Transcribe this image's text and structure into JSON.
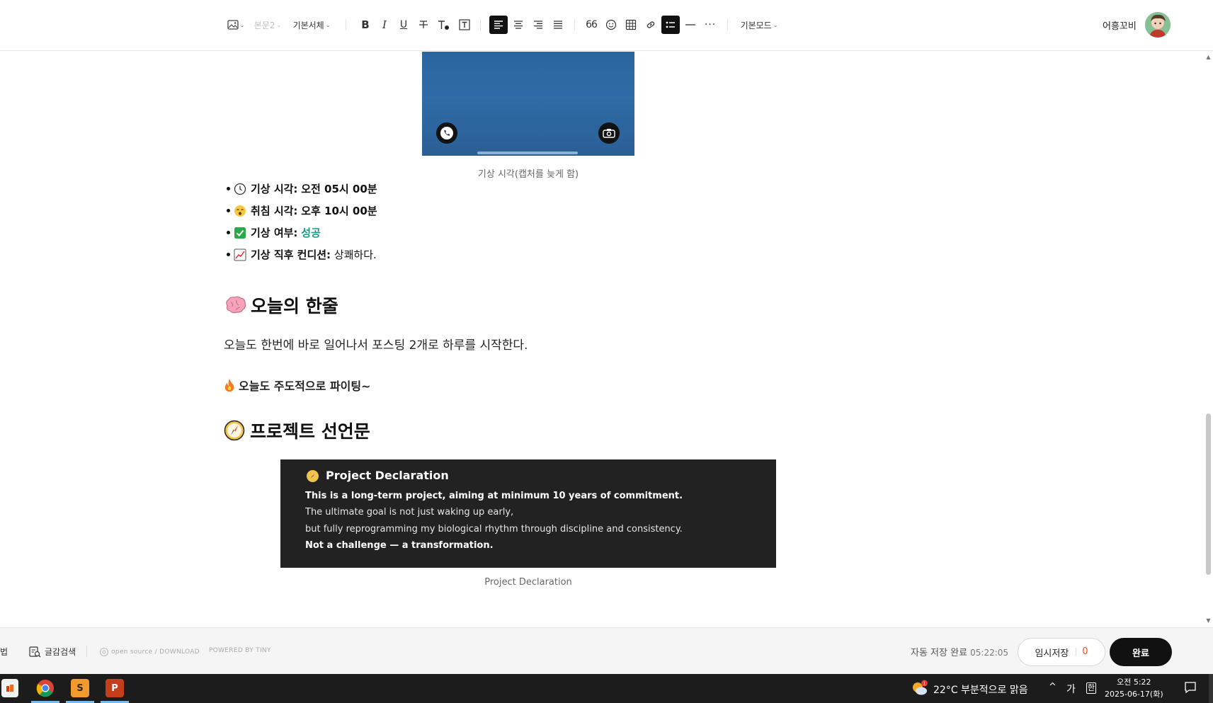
{
  "toolbar": {
    "paragraph_style": "본문2",
    "font": "기본서체",
    "mode": "기본모드",
    "bold": "B",
    "italic": "I",
    "underline": "U",
    "quote": "66",
    "more": "···"
  },
  "user": {
    "name": "어흥꼬비"
  },
  "content": {
    "image1_caption": "기상 시각(캡처를 늦게 함)",
    "bullets": [
      {
        "icon": "clock-icon",
        "label": "기상 시각:",
        "value": "오전 05시 00분",
        "value_style": "bold"
      },
      {
        "icon": "sleepy-face-icon",
        "label": "취침 시각:",
        "value": "오후 10시 00분",
        "value_style": "bold"
      },
      {
        "icon": "check-mark-icon",
        "label": "기상 여부:",
        "value": "성공",
        "value_style": "green"
      },
      {
        "icon": "chart-icon",
        "label": "기상 직후 컨디션:",
        "value": "상쾌하다.",
        "value_style": "normal"
      }
    ],
    "heading1": "오늘의 한줄",
    "paragraph1": "오늘도 한번에 바로 일어나서 포스팅 2개로 하루를 시작한다.",
    "paragraph2": "오늘도 주도적으로 파이팅~",
    "heading2": "프로젝트 선언문",
    "declaration": {
      "title": "Project Declaration",
      "lines": [
        "This is a long-term project, aiming at minimum 10 years of commitment.",
        "The ultimate goal is not just waking up early,",
        "but fully reprogramming my biological rhythm through discipline and consistency.",
        "Not a challenge — a transformation."
      ]
    },
    "image2_caption": "Project Declaration"
  },
  "footer": {
    "left_cut": "법",
    "spell_check": "글감검색",
    "open_source": "open source / DOWNLOAD",
    "powered": "POWERED BY TINY",
    "autosave_label": "자동 저장 완료",
    "autosave_time": "05:22:05",
    "temp_save_label": "임시저장",
    "temp_save_count": "0",
    "done_label": "완료"
  },
  "taskbar": {
    "weather": "22°C  부분적으로 맑음",
    "ime": "가",
    "ime2": "한",
    "time": "오전 5:22",
    "date": "2025-06-17(화)",
    "weather_badge": "1"
  },
  "colors": {
    "accent_green": "#1a9a86",
    "temp_count": "#e8541c",
    "done_bg": "#111111",
    "decl_bg": "#222222",
    "taskbar_bg": "#1c1c1c"
  }
}
